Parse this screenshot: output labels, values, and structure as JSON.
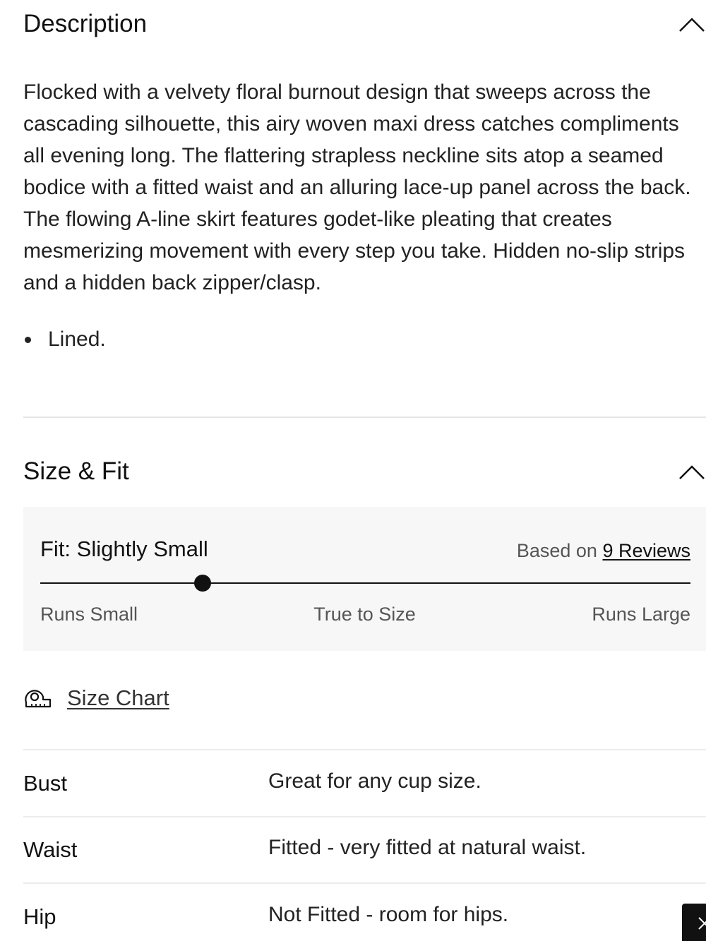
{
  "description": {
    "title": "Description",
    "body": "Flocked with a velvety floral burnout design that sweeps across the cascading silhouette, this airy woven maxi dress catches compliments all evening long. The flattering strapless neckline sits atop a seamed bodice with a fitted waist and an alluring lace-up panel across the back. The flowing A-line skirt features godet-like pleating that creates mesmerizing movement with every step you take. Hidden no-slip strips and a hidden back zipper/clasp.",
    "bullets": [
      "Lined."
    ],
    "toggle_icon": "chevron-up-icon"
  },
  "size_fit": {
    "title": "Size & Fit",
    "toggle_icon": "chevron-up-icon",
    "fit_label": "Fit: Slightly Small",
    "based_on_prefix": "Based on",
    "reviews_link": "9 Reviews",
    "fit_position": 0.25,
    "scale": {
      "left": "Runs Small",
      "middle": "True to Size",
      "right": "Runs Large"
    },
    "size_chart_icon": "measuring-tape-icon",
    "size_chart_label": "Size Chart",
    "rows": [
      {
        "label": "Bust",
        "value": "Great for any cup size."
      },
      {
        "label": "Waist",
        "value": "Fitted - very fitted at natural waist."
      },
      {
        "label": "Hip",
        "value": "Not Fitted - room for hips."
      }
    ]
  },
  "floating_button_icon": "close-icon"
}
